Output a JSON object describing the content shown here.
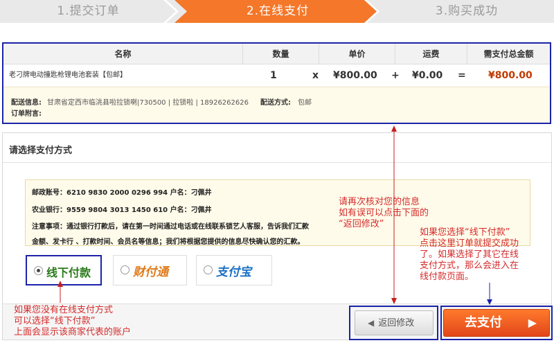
{
  "steps": {
    "step1": "1.提交订单",
    "step2": "2.在线支付",
    "step3": "3.购买成功"
  },
  "order": {
    "headers": [
      "名称",
      "数量",
      "单价",
      "运费",
      "需支付总金额"
    ],
    "item": {
      "name": "老刁牌电动撞匙枪锂电池套装【包邮】",
      "quantity": "1",
      "times": "x",
      "unit_price": "¥800.00",
      "plus": "+",
      "shipping": "¥0.00",
      "equals": "=",
      "total": "¥800.00"
    },
    "delivery_label": "配送信息:",
    "delivery_value": "甘肃省定西市临洮县啦拉锁喇|730500 | 拉锁啦 | 18926262626",
    "method_label": "配送方式:",
    "method_value": "包邮",
    "note_label": "订单附言:"
  },
  "payment": {
    "title": "请选择支付方式",
    "bank_lines": [
      "邮政账号：6210 9830 2000 0296 994 户名：刁佩井",
      "农业银行：9559 9804 3013 1450 610 户名：刁佩井",
      "注意事项：通过银行打款后，请在第一时间通过电话或在线联系锁艺人客服，告诉我们汇款",
      "金额、发卡行 、打款时间、会员名等信息；我们将根据您提供的信息尽快确认您的汇款。"
    ],
    "options": {
      "offline": "线下付款",
      "tenpay": "财付通",
      "alipay": "支付宝"
    },
    "back_button": "返回修改",
    "pay_button": "去支付"
  },
  "annotations": {
    "verify": [
      "请再次核对您的信息",
      "如有误可以点击下面的",
      "“返回修改”"
    ],
    "offline_hint": [
      "如果您选择“线下付款”",
      "点击这里订单就提交成功",
      "了。如果选择了其它在线",
      "支付方式，那么会进入在",
      "线付款页面。"
    ],
    "no_online": [
      "如果您没有在线支付方式",
      "可以选择“线下付款”",
      "上面会显示该商家代表的账户"
    ]
  },
  "colors": {
    "active_step": "#f4772a",
    "highlight_border": "#1a23a8",
    "annotation": "#d42b2b",
    "price": "#c03a00"
  },
  "icons": {
    "back_arrow": "left-triangle-icon",
    "pay_arrow": "right-triangle-icon"
  }
}
